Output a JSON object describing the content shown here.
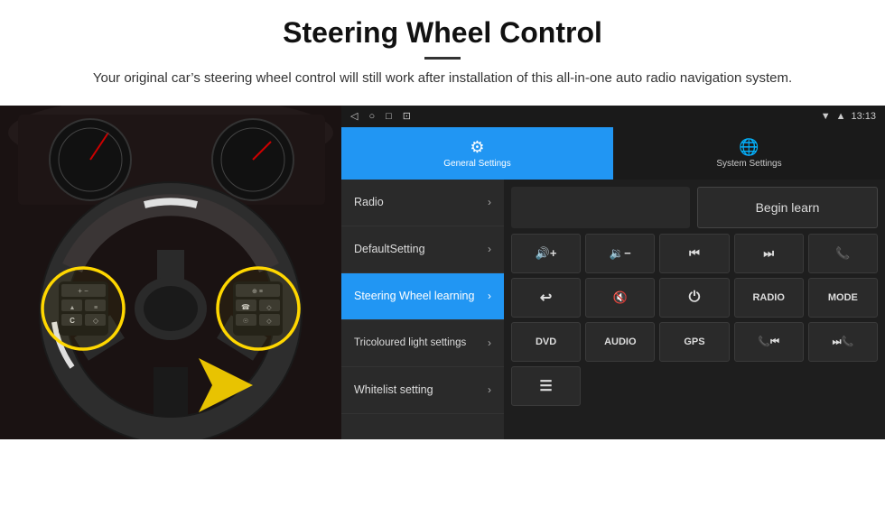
{
  "header": {
    "title": "Steering Wheel Control",
    "subtitle": "Your original car’s steering wheel control will still work after installation of this all-in-one auto radio navigation system."
  },
  "status_bar": {
    "time": "13:13",
    "nav_icons": [
      "◁",
      "○",
      "□",
      "☒"
    ]
  },
  "tabs": [
    {
      "id": "general",
      "label": "General Settings",
      "icon": "⚙",
      "active": true
    },
    {
      "id": "system",
      "label": "System Settings",
      "icon": "☉",
      "active": false
    }
  ],
  "menu_items": [
    {
      "id": "radio",
      "label": "Radio",
      "active": false
    },
    {
      "id": "default",
      "label": "DefaultSetting",
      "active": false
    },
    {
      "id": "steering",
      "label": "Steering Wheel learning",
      "active": true
    },
    {
      "id": "tricoloured",
      "label": "Tricoloured light settings",
      "active": false
    },
    {
      "id": "whitelist",
      "label": "Whitelist setting",
      "active": false
    }
  ],
  "begin_learn_label": "Begin learn",
  "control_buttons": {
    "row1": [
      {
        "id": "vol-up",
        "label": "🔊+",
        "icon": true
      },
      {
        "id": "vol-down",
        "label": "🔉−",
        "icon": true
      },
      {
        "id": "prev",
        "label": "⏮",
        "icon": true
      },
      {
        "id": "next",
        "label": "⏭",
        "icon": true
      },
      {
        "id": "phone",
        "label": "📞",
        "icon": true
      }
    ],
    "row2": [
      {
        "id": "hangup",
        "label": "↩",
        "icon": true
      },
      {
        "id": "mute",
        "label": "🔇×",
        "icon": true
      },
      {
        "id": "power",
        "label": "⏻",
        "icon": true
      },
      {
        "id": "radio-btn",
        "label": "RADIO",
        "text": true
      },
      {
        "id": "mode-btn",
        "label": "MODE",
        "text": true
      }
    ],
    "row3": [
      {
        "id": "dvd",
        "label": "DVD",
        "text": true
      },
      {
        "id": "audio",
        "label": "AUDIO",
        "text": true
      },
      {
        "id": "gps",
        "label": "GPS",
        "text": true
      },
      {
        "id": "phone2",
        "label": "📞⏮",
        "text": true
      },
      {
        "id": "skip",
        "label": "⏭📞",
        "text": true
      }
    ],
    "row4": [
      {
        "id": "list-icon",
        "label": "☰",
        "text": true
      }
    ]
  }
}
